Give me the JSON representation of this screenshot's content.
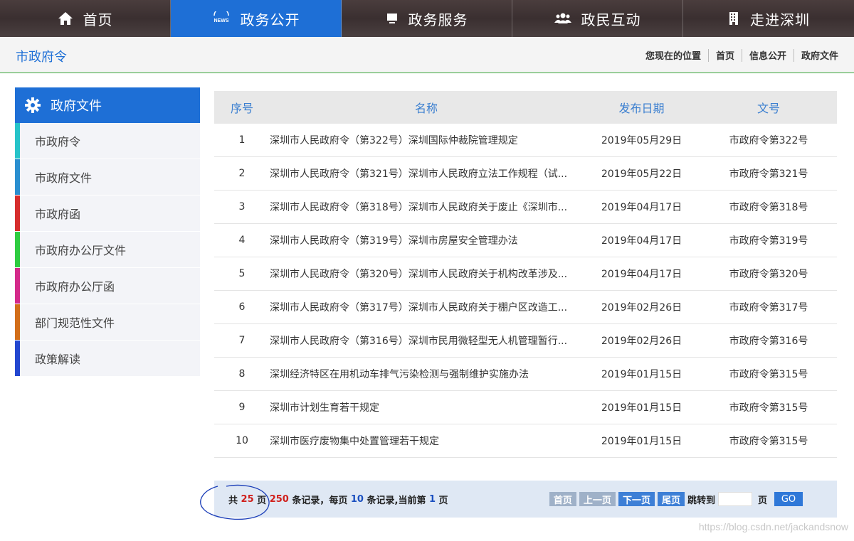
{
  "nav": {
    "items": [
      {
        "label": "首页",
        "icon": "home-icon"
      },
      {
        "label": "政务公开",
        "icon": "news-icon",
        "active": true
      },
      {
        "label": "政务服务",
        "icon": "monitor-icon"
      },
      {
        "label": "政民互动",
        "icon": "users-icon"
      },
      {
        "label": "走进深圳",
        "icon": "building-icon"
      }
    ]
  },
  "location": {
    "title": "市政府令",
    "prefix": "您现在的位置",
    "crumbs": [
      "首页",
      "信息公开",
      "政府文件"
    ]
  },
  "sidebar": {
    "title": "政府文件",
    "items": [
      {
        "label": "市政府令",
        "color": "#26c3c9"
      },
      {
        "label": "市政府文件",
        "color": "#2a8fd0"
      },
      {
        "label": "市政府函",
        "color": "#d62d2d"
      },
      {
        "label": "市政府办公厅文件",
        "color": "#2ecc40"
      },
      {
        "label": "市政府办公厅函",
        "color": "#d42a8a"
      },
      {
        "label": "部门规范性文件",
        "color": "#d26e1a"
      },
      {
        "label": "政策解读",
        "color": "#2347d0"
      }
    ]
  },
  "table": {
    "headers": {
      "no": "序号",
      "name": "名称",
      "date": "发布日期",
      "doc": "文号"
    },
    "rows": [
      {
        "no": "1",
        "name": "深圳市人民政府令（第322号）深圳国际仲裁院管理规定",
        "date": "2019年05月29日",
        "doc": "市政府令第322号"
      },
      {
        "no": "2",
        "name": "深圳市人民政府令（第321号）深圳市人民政府立法工作规程（试...",
        "date": "2019年05月22日",
        "doc": "市政府令第321号"
      },
      {
        "no": "3",
        "name": "深圳市人民政府令（第318号）深圳市人民政府关于废止《深圳市...",
        "date": "2019年04月17日",
        "doc": "市政府令第318号"
      },
      {
        "no": "4",
        "name": "深圳市人民政府令（第319号）深圳市房屋安全管理办法",
        "date": "2019年04月17日",
        "doc": "市政府令第319号"
      },
      {
        "no": "5",
        "name": "深圳市人民政府令（第320号）深圳市人民政府关于机构改革涉及...",
        "date": "2019年04月17日",
        "doc": "市政府令第320号"
      },
      {
        "no": "6",
        "name": "深圳市人民政府令（第317号）深圳市人民政府关于棚户区改造工...",
        "date": "2019年02月26日",
        "doc": "市政府令第317号"
      },
      {
        "no": "7",
        "name": "深圳市人民政府令（第316号）深圳市民用微轻型无人机管理暂行...",
        "date": "2019年02月26日",
        "doc": "市政府令第316号"
      },
      {
        "no": "8",
        "name": "深圳经济特区在用机动车排气污染检测与强制维护实施办法",
        "date": "2019年01月15日",
        "doc": "市政府令第315号"
      },
      {
        "no": "9",
        "name": "深圳市计划生育若干规定",
        "date": "2019年01月15日",
        "doc": "市政府令第315号"
      },
      {
        "no": "10",
        "name": "深圳市医疗废物集中处置管理若干规定",
        "date": "2019年01月15日",
        "doc": "市政府令第315号"
      }
    ]
  },
  "pager": {
    "t1": "共 ",
    "total_pages": "25",
    "t2": " 页 ",
    "total_records": "250",
    "t3": " 条记录，每页 ",
    "per_page": "10",
    "t4": " 条记录,当前第 ",
    "current": "1",
    "t5": " 页",
    "first": "首页",
    "prev": "上一页",
    "next": "下一页",
    "last": "尾页",
    "jump_label": "跳转到",
    "page_suffix": "页",
    "go": "GO",
    "jump_value": ""
  },
  "watermark": "https://blog.csdn.net/jackandsnow"
}
